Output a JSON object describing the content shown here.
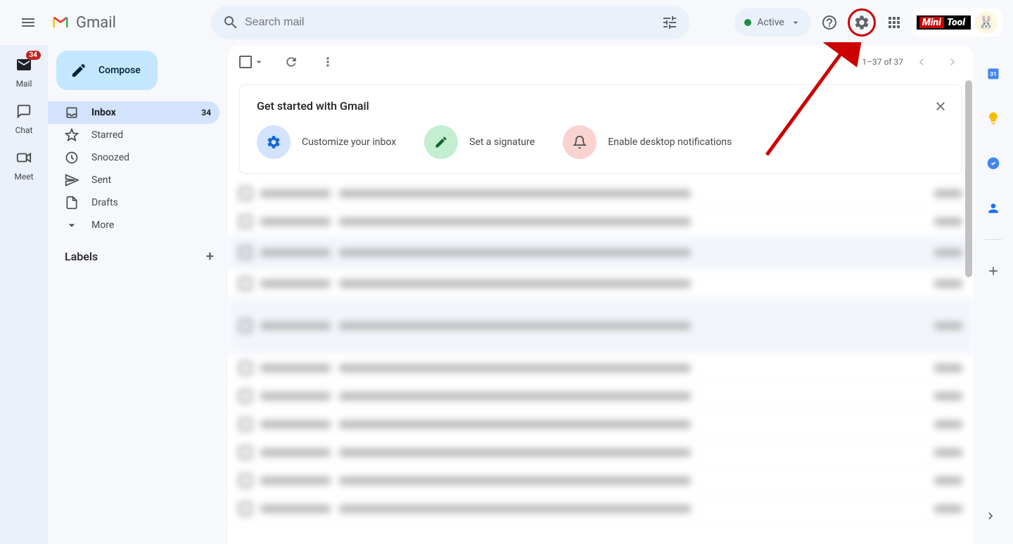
{
  "header": {
    "app_name": "Gmail",
    "search_placeholder": "Search mail",
    "status_label": "Active"
  },
  "left_rail": {
    "mail": {
      "label": "Mail",
      "badge": "34"
    },
    "chat": {
      "label": "Chat"
    },
    "meet": {
      "label": "Meet"
    }
  },
  "sidebar": {
    "compose_label": "Compose",
    "inbox": {
      "label": "Inbox",
      "count": "34"
    },
    "starred": {
      "label": "Starred"
    },
    "snoozed": {
      "label": "Snoozed"
    },
    "sent": {
      "label": "Sent"
    },
    "drafts": {
      "label": "Drafts"
    },
    "more": {
      "label": "More"
    },
    "labels_header": "Labels"
  },
  "toolbar": {
    "pagination": "1–37 of 37"
  },
  "get_started": {
    "title": "Get started with Gmail",
    "customize": "Customize your inbox",
    "signature": "Set a signature",
    "notifications": "Enable desktop notifications"
  },
  "brand": {
    "part1": "Mini",
    "part2": "Tool"
  },
  "colors": {
    "accent": "#c2e7ff",
    "highlight": "#cc0000",
    "active_bg": "#d3e3fd"
  }
}
